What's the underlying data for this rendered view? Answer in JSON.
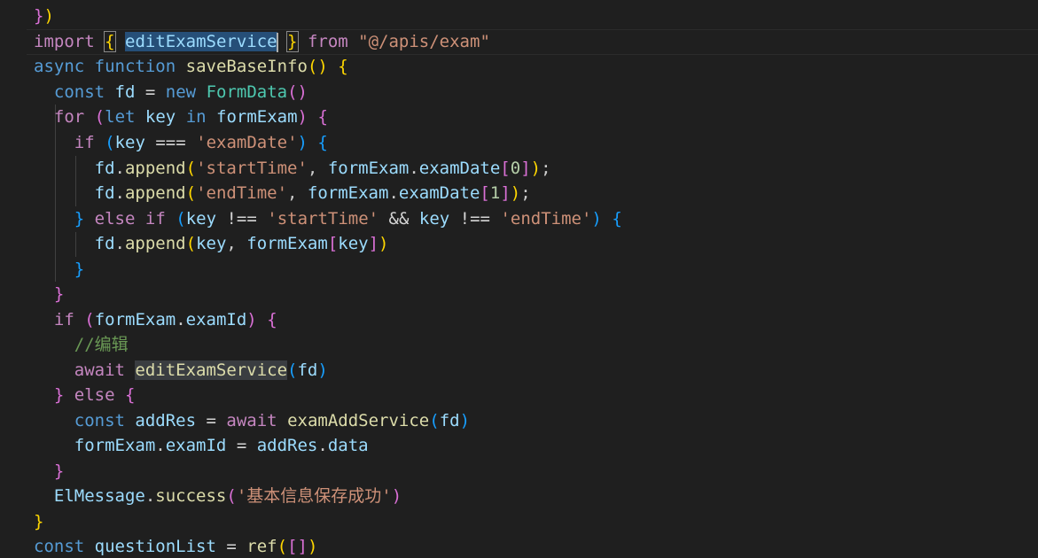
{
  "editor": {
    "language": "javascript",
    "lines": [
      "})",
      "import { editExamService } from \"@/apis/exam\"",
      "async function saveBaseInfo() {",
      "  const fd = new FormData()",
      "  for (let key in formExam) {",
      "    if (key === 'examDate') {",
      "      fd.append('startTime', formExam.examDate[0]);",
      "      fd.append('endTime', formExam.examDate[1]);",
      "    } else if (key !== 'startTime' && key !== 'endTime') {",
      "      fd.append(key, formExam[key])",
      "    }",
      "  }",
      "  if (formExam.examId) {",
      "    //编辑",
      "    await editExamService(fd)",
      "  } else {",
      "    const addRes = await examAddService(fd)",
      "    formExam.examId = addRes.data",
      "  }",
      "  ElMessage.success('基本信息保存成功')",
      "}",
      "const questionList = ref([])"
    ],
    "selected_identifier": "editExamService"
  },
  "colors": {
    "background": "#1f1f1f",
    "keyword": "#569cd6",
    "control": "#c586c0",
    "function": "#dcdcaa",
    "variable": "#9cdcfe",
    "class": "#4ec9b0",
    "string": "#ce9178",
    "number": "#b5cea8",
    "comment": "#6a9955",
    "selection": "#264f78"
  }
}
